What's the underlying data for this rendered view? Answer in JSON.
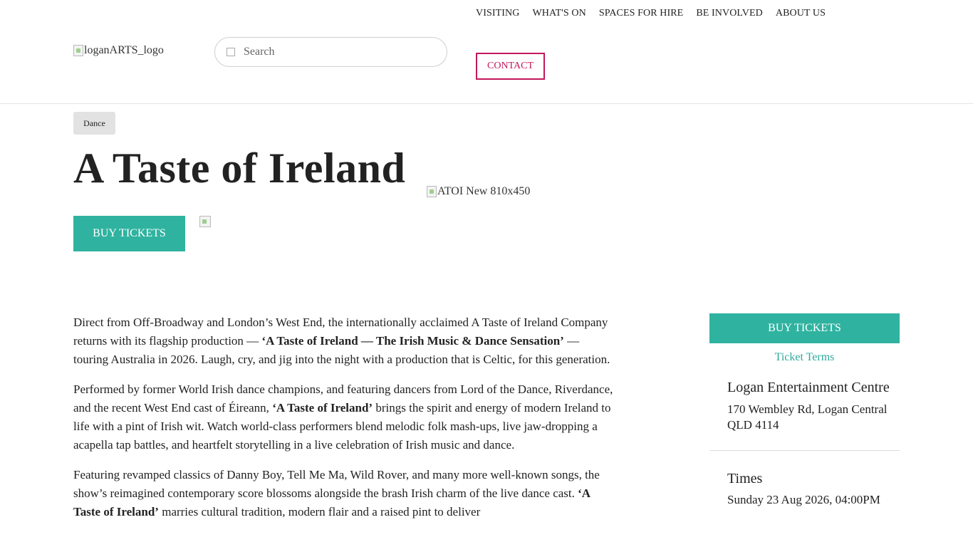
{
  "header": {
    "logo_alt": "loganARTS_logo",
    "search_placeholder": "Search",
    "nav": [
      "VISITING",
      "WHAT'S ON",
      "SPACES FOR HIRE",
      "BE INVOLVED",
      "ABOUT US"
    ],
    "contact_label": "CONTACT"
  },
  "event": {
    "category": "Dance",
    "title": "A Taste of Ireland",
    "hero_image_alt": "ATOI New 810x450",
    "buy_tickets_label": "BUY TICKETS"
  },
  "body": {
    "p1_a": "Direct from Off-Broadway and London’s West End, the internationally acclaimed A Taste of Ireland Company returns with its flagship production — ",
    "p1_b": "‘A Taste of Ireland — The Irish Music & Dance Sensation’",
    "p1_c": " — touring Australia in 2026. Laugh, cry, and jig into the night with a production that is Celtic, for this generation.",
    "p2_a": "Performed by former World Irish dance champions, and featuring dancers from Lord of the Dance, Riverdance, and the recent West End cast of Éireann, ",
    "p2_b": "‘A Taste of Ireland’",
    "p2_c": " brings the spirit and energy of modern Ireland to life with a pint of Irish wit. Watch world-class performers blend melodic folk mash-ups, live jaw-dropping a acapella tap battles, and heartfelt storytelling in a live celebration of Irish music and dance.",
    "p3_a": "Featuring revamped classics of Danny Boy, Tell Me Ma, Wild Rover, and many more well-known songs, the show’s reimagined contemporary score blossoms alongside the brash Irish charm of the live dance cast. ",
    "p3_b": "‘A Taste of Ireland’",
    "p3_c": " marries cultural tradition, modern flair and a raised pint to deliver"
  },
  "sidebar": {
    "buy_tickets_label": "BUY TICKETS",
    "ticket_terms": "Ticket Terms",
    "venue_name": "Logan Entertainment Centre",
    "venue_address": "170 Wembley Rd, Logan Central QLD 4114",
    "times_label": "Times",
    "times_value": "Sunday 23 Aug 2026, 04:00PM"
  },
  "colors": {
    "accent_teal": "#2fb3a0",
    "contact_magenta": "#c2185b"
  }
}
